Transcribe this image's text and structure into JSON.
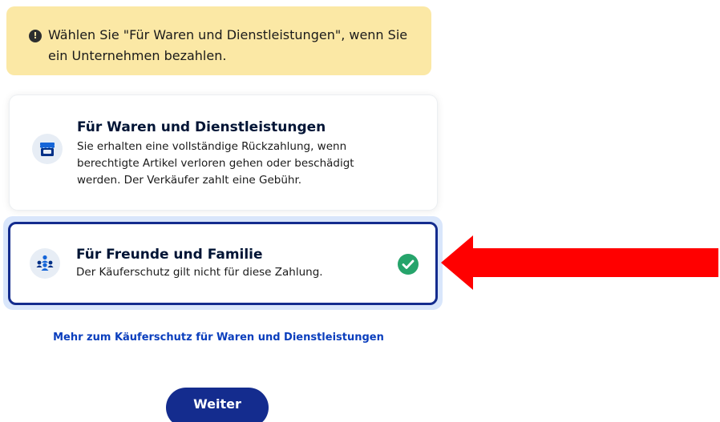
{
  "banner": {
    "text": "Wählen Sie \"Für Waren und Dienstleistungen\", wenn Sie ein Unternehmen bezahlen.",
    "icon": "exclamation-icon"
  },
  "options": [
    {
      "title": "Für Waren und Dienstleistungen",
      "description": "Sie erhalten eine vollständige Rückzahlung, wenn berechtigte Artikel verloren gehen oder beschädigt werden. Der Verkäufer zahlt eine Gebühr.",
      "icon": "storefront-icon",
      "selected": false
    },
    {
      "title": "Für Freunde und Familie",
      "description": "Der Käuferschutz gilt nicht für diese Zahlung.",
      "icon": "people-group-icon",
      "selected": true
    }
  ],
  "more_link": "Mehr zum Käuferschutz für Waren und Dienstleistungen",
  "continue_label": "Weiter",
  "colors": {
    "banner_bg": "#fbe8a5",
    "primary": "#142c8e",
    "link": "#0a3ebd",
    "icon_blue": "#1565d8",
    "check_green": "#26a46b",
    "arrow_red": "#ff0000",
    "selected_halo": "#d9e6fb"
  }
}
